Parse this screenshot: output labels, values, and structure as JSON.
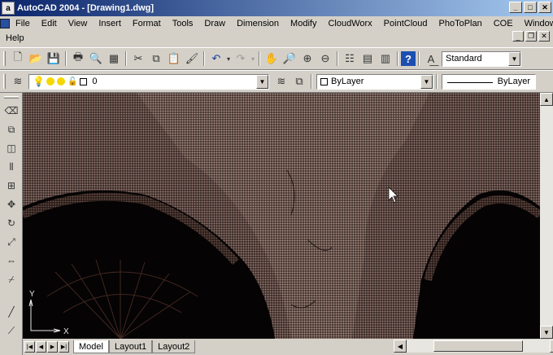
{
  "window": {
    "title": "AutoCAD 2004 - [Drawing1.dwg]",
    "app_icon": "autocad-icon"
  },
  "menu": {
    "items": [
      "File",
      "Edit",
      "View",
      "Insert",
      "Format",
      "Tools",
      "Draw",
      "Dimension",
      "Modify",
      "CloudWorx",
      "PointCloud",
      "PhoToPlan",
      "COE",
      "Window"
    ],
    "help": "Help"
  },
  "toolbar": {
    "text_style": "Standard",
    "layer": "0",
    "color": "ByLayer",
    "linetype": "ByLayer"
  },
  "ucs": {
    "x_label": "X",
    "y_label": "Y"
  },
  "tabs": [
    "Model",
    "Layout1",
    "Layout2"
  ],
  "colors": {
    "canvas_bg": "#0b0807",
    "titlebar_start": "#0a246a",
    "titlebar_end": "#a6caf0",
    "pointcloud": "#8a6e66"
  }
}
